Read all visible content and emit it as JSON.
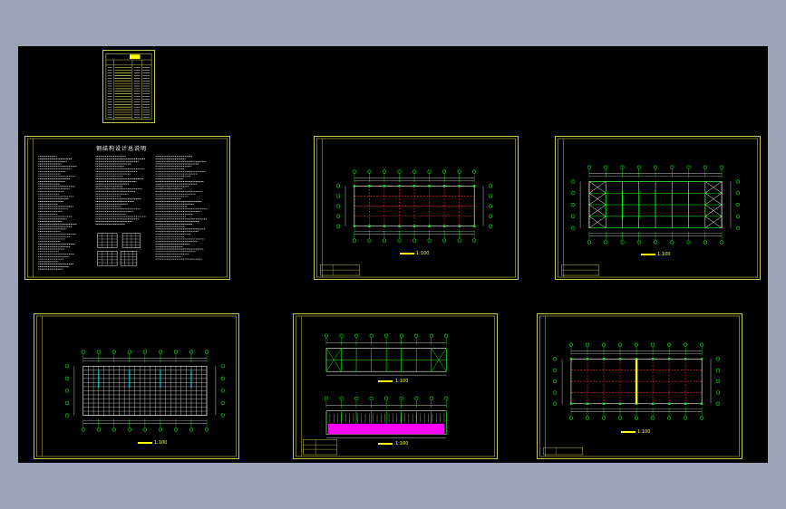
{
  "app": {
    "background_color": "#9aa4b6",
    "canvas_color": "#000000",
    "frame_color": "#c9c94a",
    "axis_color": "#00ff00",
    "column_color": "#ff3333",
    "fill_color": "#ff00ff"
  },
  "drawing_index": {
    "name": "drawing-index-table"
  },
  "sheets": [
    {
      "id": "design-notes",
      "title": "钢结构设计总说明"
    },
    {
      "id": "column-plan",
      "caption": "",
      "scale": "1:100"
    },
    {
      "id": "roof-bracing-plan",
      "caption": "",
      "scale": "1:100"
    },
    {
      "id": "purlin-plan",
      "caption": "",
      "scale": "1:100"
    },
    {
      "id": "elevations",
      "caption": "",
      "scale": "1:100"
    },
    {
      "id": "anchor-plan",
      "caption": "",
      "scale": "1:100"
    }
  ]
}
